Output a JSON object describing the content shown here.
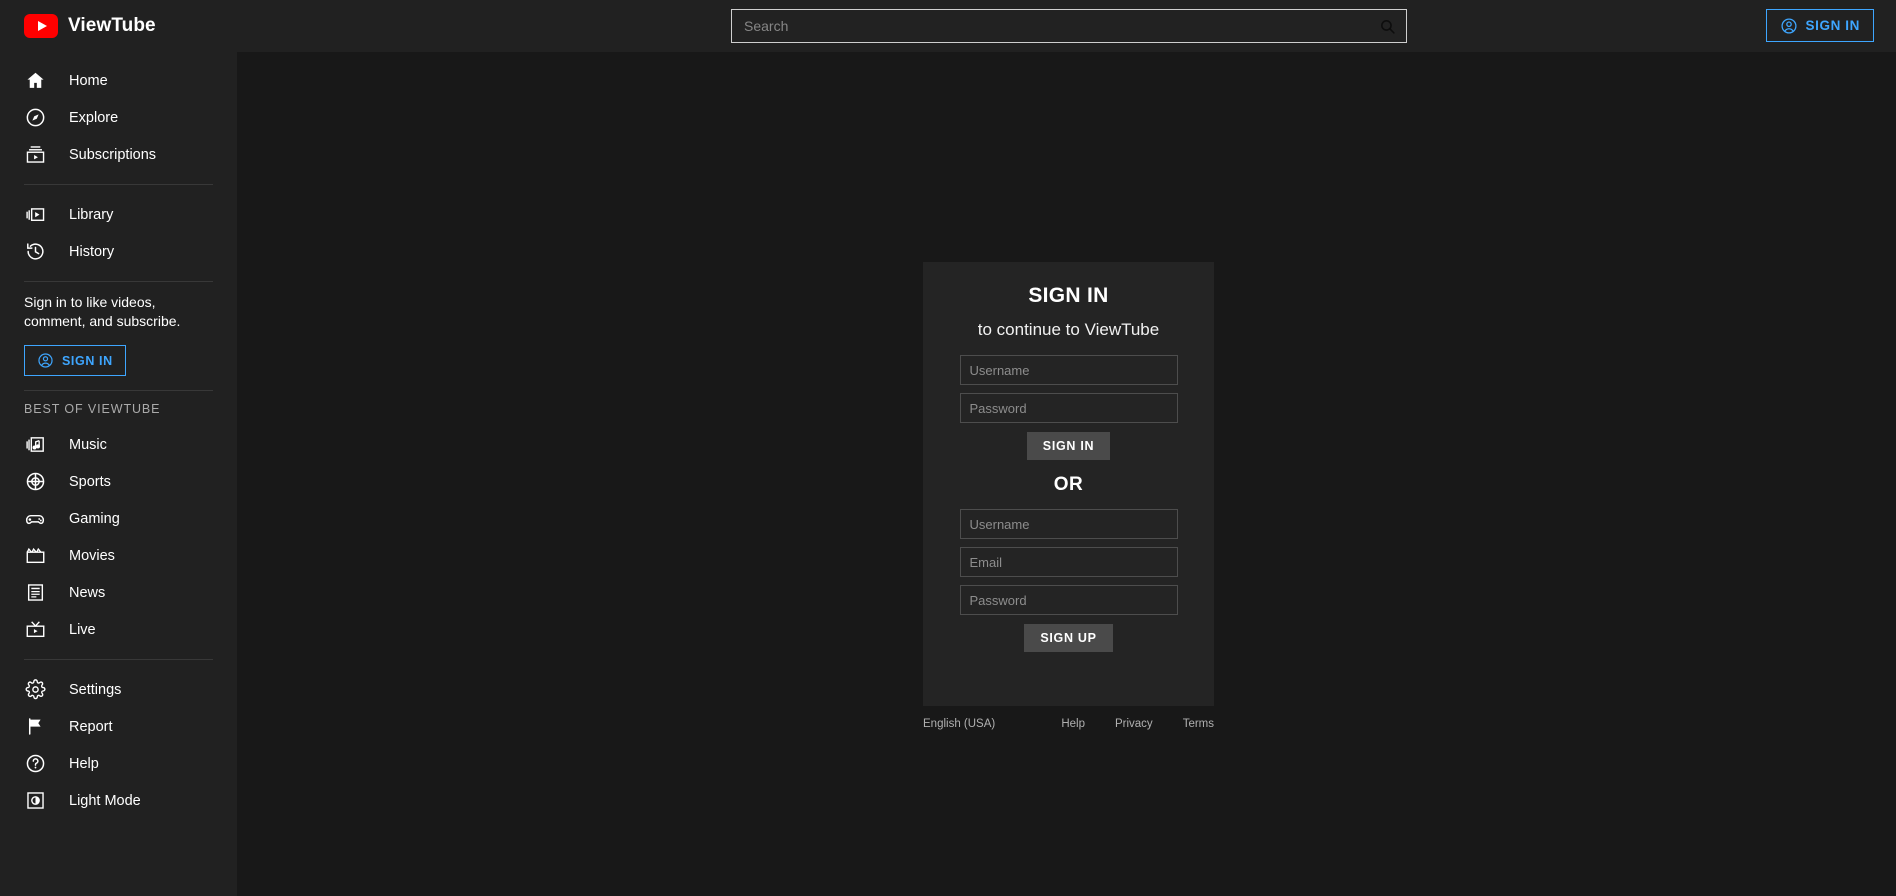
{
  "header": {
    "brand": {
      "name": "ViewTube",
      "logo_icon": "youtube-play-logo",
      "accent": "#ff0000"
    },
    "search": {
      "placeholder": "Search",
      "value": "",
      "icon": "search-icon"
    },
    "sign_in": {
      "label": "SIGN IN",
      "icon": "account-circle-icon",
      "accent": "#3ea6ff"
    }
  },
  "sidebar": {
    "primary": [
      {
        "label": "Home",
        "icon": "home-icon"
      },
      {
        "label": "Explore",
        "icon": "compass-icon"
      },
      {
        "label": "Subscriptions",
        "icon": "subscriptions-icon"
      }
    ],
    "secondary": [
      {
        "label": "Library",
        "icon": "library-icon"
      },
      {
        "label": "History",
        "icon": "history-icon"
      }
    ],
    "signin_prompt": "Sign in to like videos, comment, and subscribe.",
    "signin_button": {
      "label": "SIGN IN",
      "icon": "account-circle-icon"
    },
    "section_title": "BEST OF VIEWTUBE",
    "categories": [
      {
        "label": "Music",
        "icon": "music-icon"
      },
      {
        "label": "Sports",
        "icon": "sports-ball-icon"
      },
      {
        "label": "Gaming",
        "icon": "gamepad-icon"
      },
      {
        "label": "Movies",
        "icon": "clapperboard-icon"
      },
      {
        "label": "News",
        "icon": "news-article-icon"
      },
      {
        "label": "Live",
        "icon": "live-tv-icon"
      }
    ],
    "utility": [
      {
        "label": "Settings",
        "icon": "gear-icon"
      },
      {
        "label": "Report",
        "icon": "flag-icon"
      },
      {
        "label": "Help",
        "icon": "question-circle-icon"
      },
      {
        "label": "Light Mode",
        "icon": "brightness-contrast-icon"
      }
    ]
  },
  "auth_card": {
    "title": "SIGN IN",
    "subtitle": "to continue to ViewTube",
    "signin_form": {
      "username_placeholder": "Username",
      "username_value": "",
      "password_placeholder": "Password",
      "password_value": "",
      "submit_label": "SIGN IN"
    },
    "divider_label": "OR",
    "signup_form": {
      "username_placeholder": "Username",
      "username_value": "",
      "email_placeholder": "Email",
      "email_value": "",
      "password_placeholder": "Password",
      "password_value": "",
      "submit_label": "SIGN UP"
    }
  },
  "footer": {
    "language": "English (USA)",
    "links": [
      "Help",
      "Privacy",
      "Terms"
    ]
  }
}
